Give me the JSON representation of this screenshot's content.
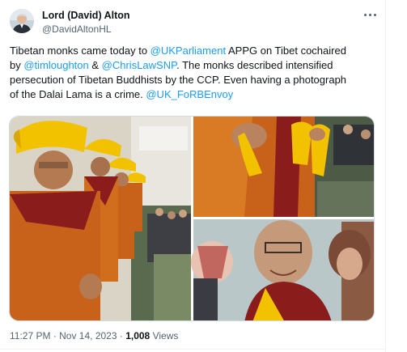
{
  "tweet": {
    "author": {
      "name": "Lord (David) Alton",
      "handle": "@DavidAltonHL"
    },
    "text": {
      "line1_a": "Tibetan monks came today to ",
      "line1_link": "@UKParliament",
      "line1_b": " APPG on Tibet cochaired",
      "line2_a": "by ",
      "line2_link1": "@timloughton",
      "line2_mid": " & ",
      "line2_link2": "@ChrisLawSNP",
      "line2_b": ". The monks described intensified",
      "line3": "persecution of Tibetan Buddhists by the CCP. Even having a photograph",
      "line4_a": "of the Dalai Lama is a crime.  ",
      "line4_link": "@UK_FoRBEnvoy"
    },
    "timestamp": "11:27 PM · Nov 14, 2023",
    "separator": " · ",
    "views_count": "1,008",
    "views_label": " Views"
  },
  "icons": {
    "more": "more-options-icon"
  },
  "colors": {
    "link": "#1d9bf0",
    "robe": "#c8621a",
    "hat": "#f2c200",
    "maroon": "#8a1c1c"
  }
}
